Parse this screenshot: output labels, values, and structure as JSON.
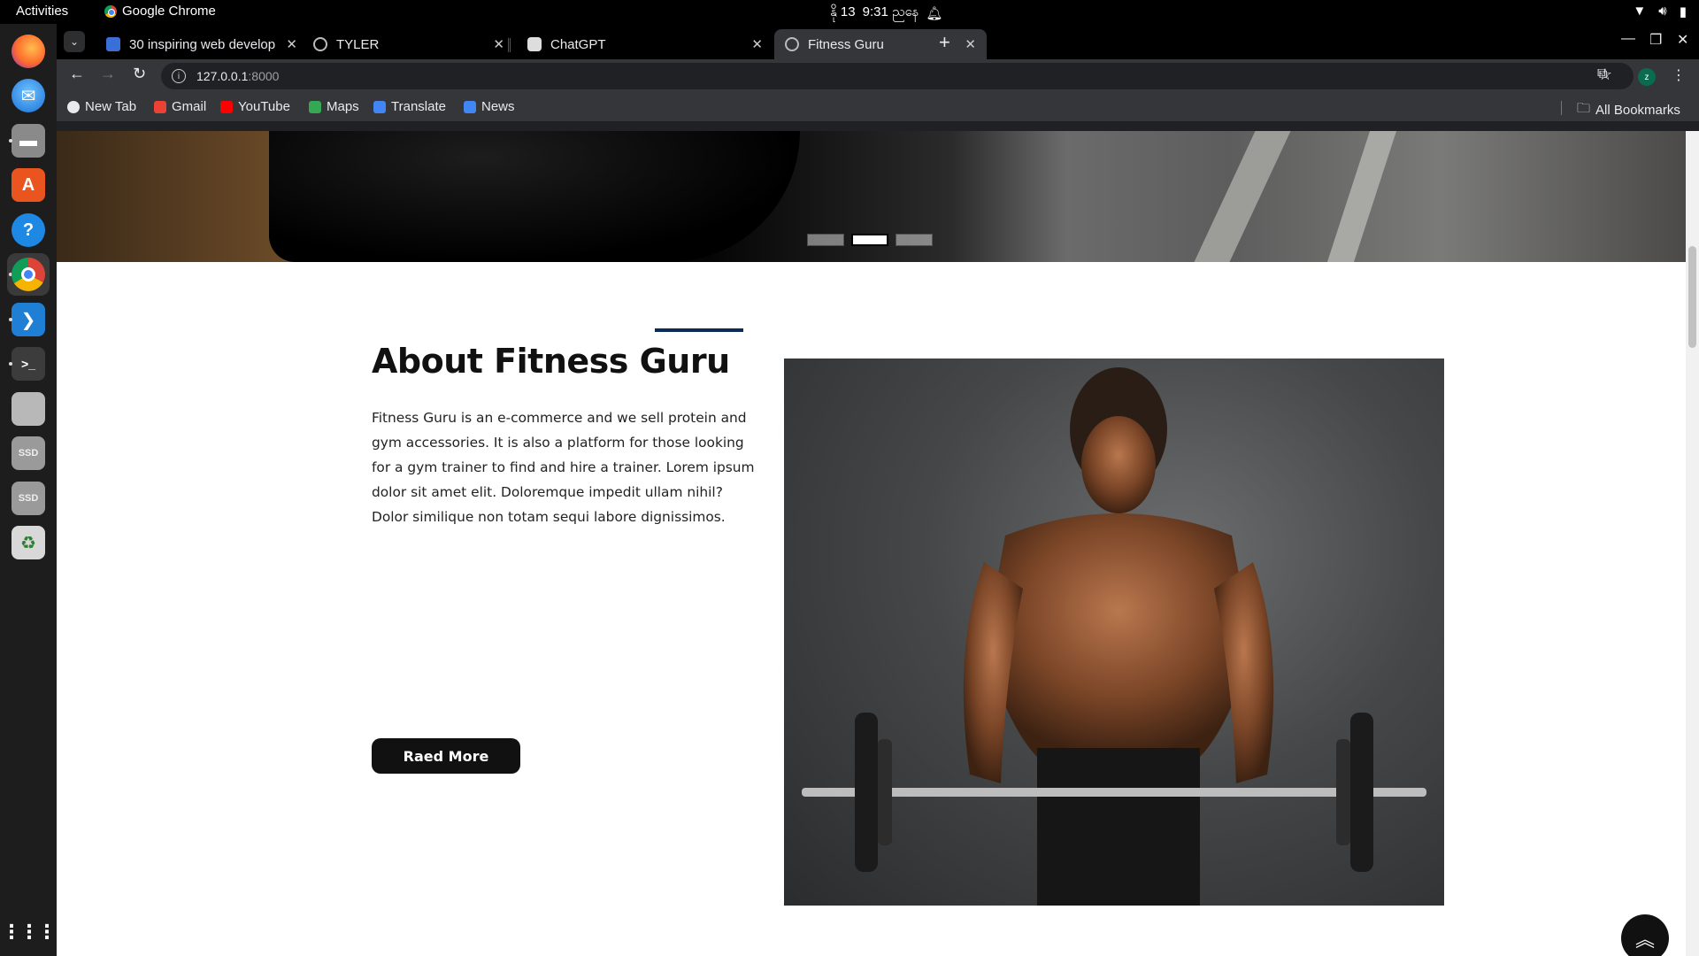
{
  "topbar": {
    "activities": "Activities",
    "app_name": "Google Chrome",
    "clock_date": "နို 13",
    "clock_time": "9:31 ညနေ"
  },
  "browser": {
    "tabs": [
      {
        "title": "30 inspiring web develop",
        "favicon_color": "#3b6fd8"
      },
      {
        "title": "TYLER",
        "favicon_color": "#bbbbbb"
      },
      {
        "title": "ChatGPT",
        "favicon_color": "#dddddd"
      },
      {
        "title": "Fitness Guru",
        "favicon_color": "#bbbbbb",
        "active": true
      }
    ],
    "url_host": "127.0.0.1",
    "url_port": ":8000",
    "profile_initial": "z",
    "bookmarks": [
      {
        "label": "New Tab",
        "color": "#e8eaed"
      },
      {
        "label": "Gmail",
        "color": "#ea4335"
      },
      {
        "label": "YouTube",
        "color": "#ff0000"
      },
      {
        "label": "Maps",
        "color": "#34a853"
      },
      {
        "label": "Translate",
        "color": "#4285f4"
      },
      {
        "label": "News",
        "color": "#4285f4"
      }
    ],
    "all_bookmarks": "All Bookmarks"
  },
  "page": {
    "carousel": {
      "slides": 3,
      "active_index": 1
    },
    "about": {
      "heading": "About Fitness Guru",
      "body": "Fitness Guru is an e-commerce and we sell protein and gym accessories. It is also a platform for those looking for a gym trainer to find and hire a trainer. Lorem ipsum dolor sit amet elit. Doloremque impedit ullam nihil? Dolor similique non totam sequi labore dignissimos.",
      "button": "Raed More"
    },
    "accent_color": "#0b2a55"
  },
  "dock": {
    "apps": [
      "firefox-icon",
      "thunderbird-icon",
      "files-icon",
      "app-center-icon",
      "help-icon",
      "chrome-icon",
      "vscode-icon",
      "terminal-icon",
      "text-editor-icon",
      "ssd-drive-icon",
      "ssd-drive-icon",
      "trash-icon",
      "show-apps-icon"
    ]
  }
}
